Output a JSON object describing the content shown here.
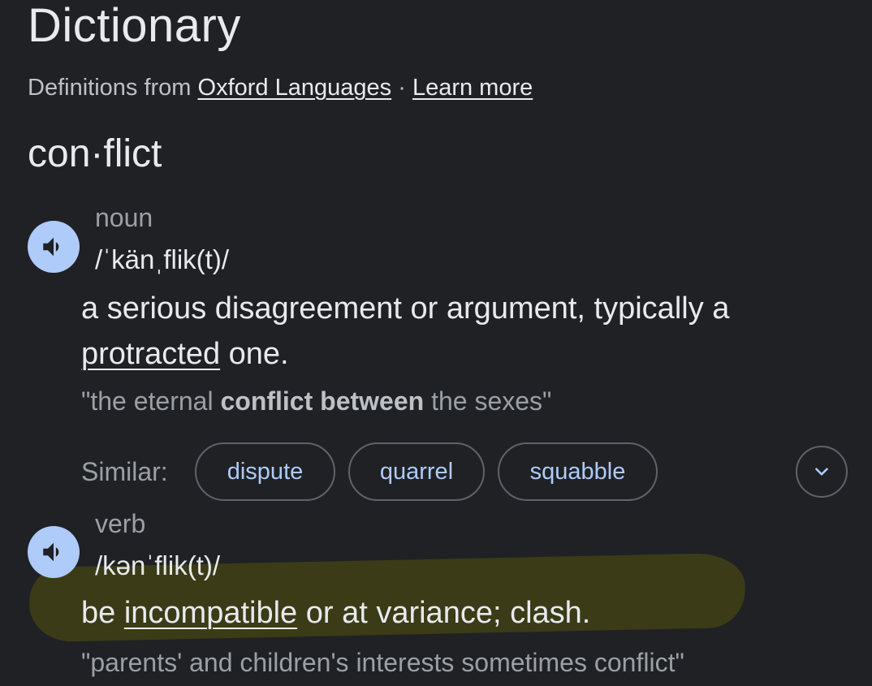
{
  "header": {
    "title": "Dictionary",
    "source_prefix": "Definitions from",
    "source_link": "Oxford Languages",
    "separator": "·",
    "learn_more": "Learn more"
  },
  "entry": {
    "headword": "con·flict"
  },
  "noun": {
    "pos": "noun",
    "pronunciation": "/ˈkänˌflik(t)/",
    "definition_line1": "a serious disagreement or argument, typically a",
    "definition_link": "protracted",
    "definition_rest": " one.",
    "example_open": "\"the eternal ",
    "example_bold": "conflict between",
    "example_close": " the sexes\"",
    "similar_label": "Similar:",
    "similar": [
      "dispute",
      "quarrel",
      "squabble"
    ],
    "expand_icon": "chevron-down-icon"
  },
  "verb": {
    "pos": "verb",
    "pronunciation": "/kənˈflik(t)/",
    "definition_pre": "be ",
    "definition_link": "incompatible",
    "definition_rest": " or at variance; clash.",
    "example": "\"parents' and children's interests sometimes conflict\""
  },
  "colors": {
    "background": "#202124",
    "accent": "#aecbfa",
    "highlight": "#3b3b17"
  },
  "icons": {
    "speaker": "speaker-icon"
  }
}
